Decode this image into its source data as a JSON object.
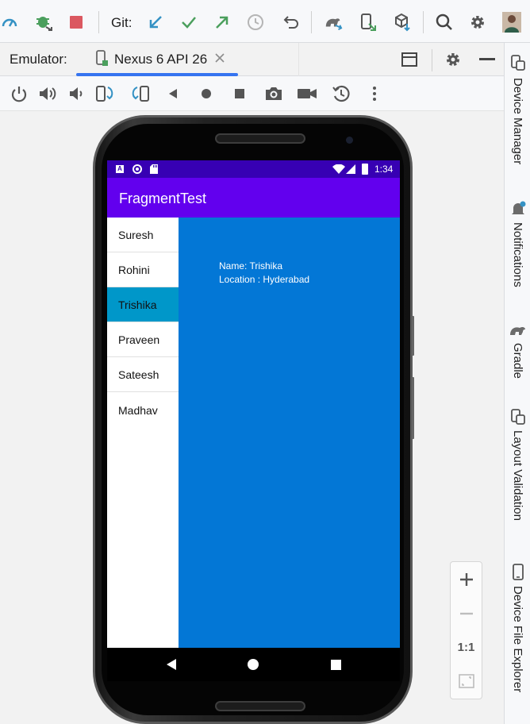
{
  "toolbar": {
    "git_label": "Git:",
    "icons": [
      "speed-icon",
      "debug-attach-icon",
      "stop-icon",
      "git-update-icon",
      "git-commit-icon",
      "git-push-icon",
      "history-icon",
      "rollback-icon",
      "gradle-sync-icon",
      "device-sync-icon",
      "package-deploy-icon",
      "search-icon",
      "settings-icon",
      "user-avatar"
    ]
  },
  "emulator": {
    "label": "Emulator:",
    "tab_label": "Nexus 6 API 26"
  },
  "side_tabs": [
    "Device Manager",
    "Notifications",
    "Gradle",
    "Layout Validation",
    "Device File Explorer"
  ],
  "device": {
    "status_time": "1:34",
    "app_title": "FragmentTest",
    "list_items": [
      "Suresh",
      "Rohini",
      "Trishika",
      "Praveen",
      "Sateesh",
      "Madhav"
    ],
    "selected_index": 2,
    "detail": {
      "name": "Name: Trishika",
      "location": "Location : Hyderabad"
    }
  },
  "zoom": {
    "actual_size_label": "1:1"
  },
  "colors": {
    "status_bar": "#3700b3",
    "app_bar": "#6200ee",
    "selected_item": "#0097c9",
    "detail_background": "#0377d6",
    "tab_underline": "#3574f0"
  }
}
